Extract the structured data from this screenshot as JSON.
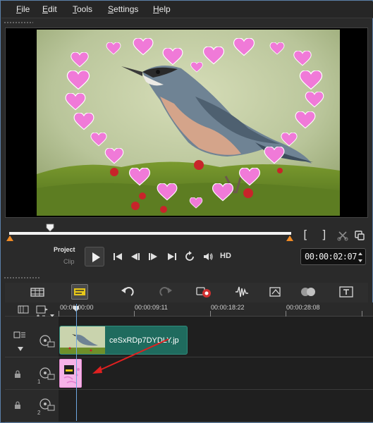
{
  "menu": {
    "file": "File",
    "edit": "Edit",
    "tools": "Tools",
    "settings": "Settings",
    "help": "Help"
  },
  "preview": {
    "mode_project": "Project",
    "mode_clip": "Clip",
    "quality": "HD",
    "timecode": "00:00:02:07",
    "scrub_position": 0.14
  },
  "timeline": {
    "ruler_labels": [
      "00:00:00:00",
      "00:00:09:11",
      "00:00:18:22",
      "00:00:28:08"
    ],
    "video_clip_name": "ceSxRDp7DYDLY.jp",
    "track_1_label": "1",
    "track_2_label": "2"
  },
  "colors": {
    "accent_orange": "#f08a24",
    "video_clip": "#1f6b5e",
    "overlay_clip": "#f6b3e8",
    "playhead": "#6fa8e0",
    "annotation_arrow": "#e02020"
  },
  "icons": {
    "play": "play-icon",
    "prev": "skip-to-start-icon",
    "step_back": "step-back-icon",
    "step_forward": "step-forward-icon",
    "next": "skip-to-end-icon",
    "repeat": "repeat-icon",
    "volume": "volume-icon"
  }
}
